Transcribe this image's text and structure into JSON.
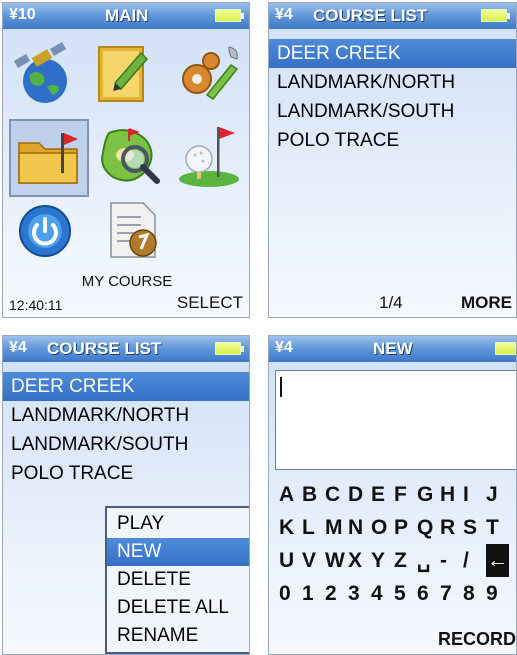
{
  "main": {
    "signal": "¥10",
    "title": "MAIN",
    "caption": "MY COURSE",
    "time": "12:40:11",
    "softkey": "SELECT",
    "icons": [
      "gps-satellite-icon",
      "scorecard-icon",
      "settings-icon",
      "my-course-folder-icon",
      "course-map-icon",
      "golf-ball-flag-icon",
      "power-icon",
      "my-course-document-icon"
    ]
  },
  "course_list": {
    "signal": "¥4",
    "title": "COURSE LIST",
    "items": [
      "DEER CREEK",
      "LANDMARK/NORTH",
      "LANDMARK/SOUTH",
      "POLO TRACE"
    ],
    "page": "1/4",
    "softkey": "MORE"
  },
  "course_menu": {
    "signal": "¥4",
    "title": "COURSE LIST",
    "items": [
      "DEER CREEK",
      "LANDMARK/NORTH",
      "LANDMARK/SOUTH",
      "POLO TRACE"
    ],
    "popup": [
      "PLAY",
      "NEW",
      "DELETE",
      "DELETE ALL",
      "RENAME"
    ]
  },
  "new_entry": {
    "signal": "¥4",
    "title": "NEW",
    "input_value": "",
    "keyboard": [
      [
        "A",
        "B",
        "C",
        "D",
        "E",
        "F",
        "G",
        "H",
        "I",
        "J"
      ],
      [
        "K",
        "L",
        "M",
        "N",
        "O",
        "P",
        "Q",
        "R",
        "S",
        "T"
      ],
      [
        "U",
        "V",
        "W",
        "X",
        "Y",
        "Z",
        "␣",
        "-",
        "/",
        "←"
      ],
      [
        "0",
        "1",
        "2",
        "3",
        "4",
        "5",
        "6",
        "7",
        "8",
        "9"
      ]
    ],
    "softkey": "RECORD"
  },
  "colors": {
    "titlebar": "#4a84d0",
    "selection": "#3d78cc",
    "battery": "#e3f65c"
  }
}
